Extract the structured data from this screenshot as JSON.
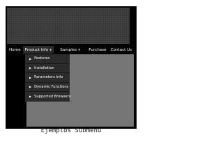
{
  "menubar": {
    "items": [
      {
        "label": "Home",
        "arrow": ""
      },
      {
        "label": "Product Info",
        "arrow": "▼"
      },
      {
        "label": "Samples",
        "arrow": "▼"
      },
      {
        "label": "Purchase",
        "arrow": ""
      },
      {
        "label": "Contact Us",
        "arrow": ""
      }
    ]
  },
  "submenu": {
    "items": [
      {
        "label": "Features"
      },
      {
        "label": "Installation"
      },
      {
        "label": "Parameters Info"
      },
      {
        "label": "Dynamic Functions"
      },
      {
        "label": "Supported Browsers"
      }
    ]
  },
  "caption": "Ejemplos Submenu"
}
